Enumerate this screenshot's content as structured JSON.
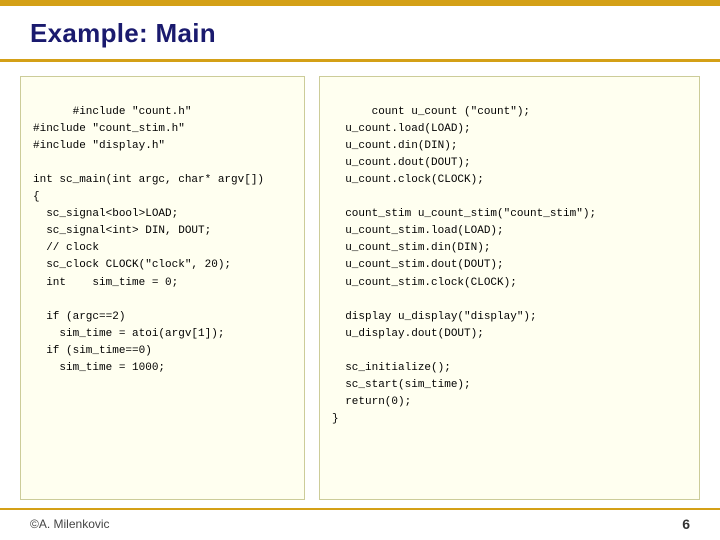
{
  "slide": {
    "title": "Example: Main",
    "top_border_color": "#D4A017",
    "code_left": "#include \"count.h\"\n#include \"count_stim.h\"\n#include \"display.h\"\n\nint sc_main(int argc, char* argv[])\n{\n  sc_signal<bool>LOAD;\n  sc_signal<int> DIN, DOUT;\n  // clock\n  sc_clock CLOCK(\"clock\", 20);\n  int    sim_time = 0;\n\n  if (argc==2)\n    sim_time = atoi(argv[1]);\n  if (sim_time==0)\n    sim_time = 1000;\n",
    "code_right": "count u_count (\"count\");\n  u_count.load(LOAD);\n  u_count.din(DIN);\n  u_count.dout(DOUT);\n  u_count.clock(CLOCK);\n\n  count_stim u_count_stim(\"count_stim\");\n  u_count_stim.load(LOAD);\n  u_count_stim.din(DIN);\n  u_count_stim.dout(DOUT);\n  u_count_stim.clock(CLOCK);\n\n  display u_display(\"display\");\n  u_display.dout(DOUT);\n\n  sc_initialize();\n  sc_start(sim_time);\n  return(0);\n}",
    "footer": {
      "credit": "©A. Milenkovic",
      "page": "6"
    }
  }
}
